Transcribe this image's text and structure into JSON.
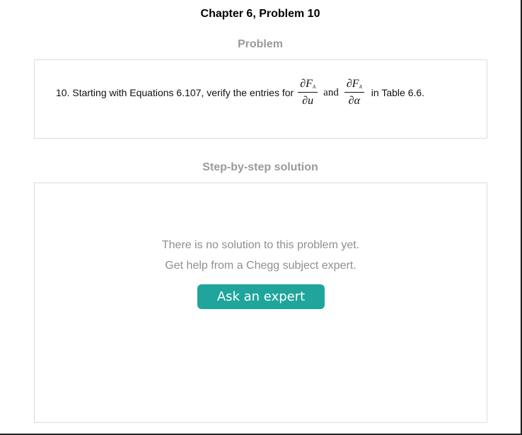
{
  "header": {
    "chapter_title": "Chapter 6, Problem 10"
  },
  "problem": {
    "heading": "Problem",
    "text_before": "10. Starting with Equations 6.107, verify the entries for",
    "frac1": {
      "num": "∂F",
      "sub": "A",
      "den": "∂u"
    },
    "conjunction": "and",
    "frac2": {
      "num": "∂F",
      "sub": "A",
      "den": "∂α"
    },
    "text_after": "in Table 6.6."
  },
  "solution": {
    "heading": "Step-by-step solution",
    "no_solution_text": "There is no solution to this problem yet.",
    "help_text": "Get help from a Chegg subject expert.",
    "ask_button_label": "Ask an expert"
  },
  "colors": {
    "accent": "#1fa59b",
    "muted_text": "#8f8f8f",
    "heading_gray": "#9a9a9a",
    "border": "#dcdcdc"
  }
}
